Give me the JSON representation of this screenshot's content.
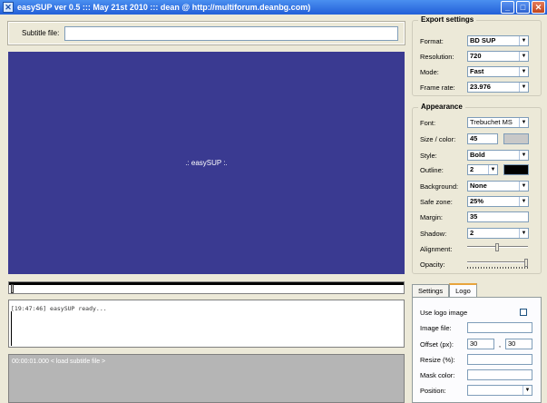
{
  "window": {
    "title": "easySUP ver 0.5 ::: May 21st 2010 ::: dean @ http://multiforum.deanbg.com)"
  },
  "subtitle": {
    "label": "Subtitle file:",
    "value": ""
  },
  "preview": {
    "text": ".: easySUP :."
  },
  "log": {
    "text": "[19:47:46] easySUP ready..."
  },
  "timeline": {
    "text": "00:00:01.000 < load subtitle file >"
  },
  "export": {
    "legend": "Export settings",
    "format": {
      "label": "Format:",
      "value": "BD SUP"
    },
    "resolution": {
      "label": "Resolution:",
      "value": "720"
    },
    "mode": {
      "label": "Mode:",
      "value": "Fast"
    },
    "frame_rate": {
      "label": "Frame rate:",
      "value": "23.976"
    }
  },
  "appearance": {
    "legend": "Appearance",
    "font": {
      "label": "Font:",
      "value": "Trebuchet MS"
    },
    "size_color": {
      "label": "Size / color:",
      "value": "45",
      "color": "#c8c8c8"
    },
    "style": {
      "label": "Style:",
      "value": "Bold"
    },
    "outline": {
      "label": "Outline:",
      "value": "2",
      "color": "#000000"
    },
    "background": {
      "label": "Background:",
      "value": "None"
    },
    "safe_zone": {
      "label": "Safe zone:",
      "value": "25%"
    },
    "margin": {
      "label": "Margin:",
      "value": "35"
    },
    "shadow": {
      "label": "Shadow:",
      "value": "2"
    },
    "alignment": {
      "label": "Alignment:",
      "level": 0.5
    },
    "opacity": {
      "label": "Opacity:",
      "level": 1.0
    }
  },
  "tabs": [
    {
      "label": "Settings"
    },
    {
      "label": "Logo"
    }
  ],
  "logo": {
    "use_logo_label": "Use logo image",
    "image_file_label": "Image file:",
    "offset_label": "Offset (px):",
    "offset_x": "30",
    "offset_sep": ",",
    "offset_y": "30",
    "resize_label": "Resize (%):",
    "mask_label": "Mask color:",
    "position_label": "Position:"
  },
  "colors": {
    "preview_bg": "#3a3a91",
    "title_bar": "#2360d8"
  },
  "icons": {
    "app": "x-app-icon",
    "minimize": "minimize-icon",
    "maximize": "maximize-icon",
    "close": "close-icon"
  }
}
